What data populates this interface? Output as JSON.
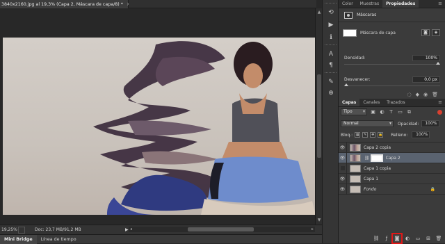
{
  "document": {
    "tab_title": "3840x2160.jpg al 19,3% (Capa 2, Máscara de capa/8) *",
    "close_glyph": "×"
  },
  "status": {
    "zoom": "19,25%",
    "doc_info": "Doc: 23,7 MB/91,2 MB",
    "play_glyph": "▶"
  },
  "bottom_tabs": [
    {
      "label": "Mini Bridge",
      "active": true
    },
    {
      "label": "Línea de tiempo",
      "active": false
    }
  ],
  "top_panel": {
    "tabs": [
      {
        "label": "Color",
        "active": false
      },
      {
        "label": "Muestras",
        "active": false
      },
      {
        "label": "Propiedades",
        "active": true
      }
    ],
    "menu_glyph": "≡",
    "header_label": "Máscaras",
    "mask_label": "Máscara de capa",
    "density_label": "Densidad:",
    "density_value": "100%",
    "feather_label": "Desvanecer:",
    "feather_value": "0,0 px"
  },
  "layers_panel": {
    "tabs": [
      {
        "label": "Capas",
        "active": true
      },
      {
        "label": "Canales",
        "active": false
      },
      {
        "label": "Trazados",
        "active": false
      }
    ],
    "filter_kind": "Tipo",
    "blend_mode": "Normal",
    "opacity_label": "Opacidad:",
    "opacity_value": "100%",
    "lock_label": "Bloq.:",
    "fill_label": "Relleno:",
    "fill_value": "100%",
    "layers": [
      {
        "name": "Capa 2 copia",
        "visible": true,
        "selected": false,
        "italic": false
      },
      {
        "name": "Capa 2",
        "visible": true,
        "selected": true,
        "italic": false
      },
      {
        "name": "Capa 1 copia",
        "visible": false,
        "selected": false,
        "italic": false
      },
      {
        "name": "Capa 1",
        "visible": true,
        "selected": false,
        "italic": false
      },
      {
        "name": "Fondo",
        "visible": true,
        "selected": false,
        "italic": true
      }
    ],
    "footer_icons": [
      "link-icon",
      "fx-icon",
      "add-mask-icon",
      "adjustment-icon",
      "group-icon",
      "new-layer-icon",
      "trash-icon"
    ],
    "highlighted_icon": "add-mask-icon",
    "highlight_color": "#e01818"
  },
  "colors": {
    "selected_layer": "#5a6370",
    "panel_bg": "#3b3b3b"
  }
}
